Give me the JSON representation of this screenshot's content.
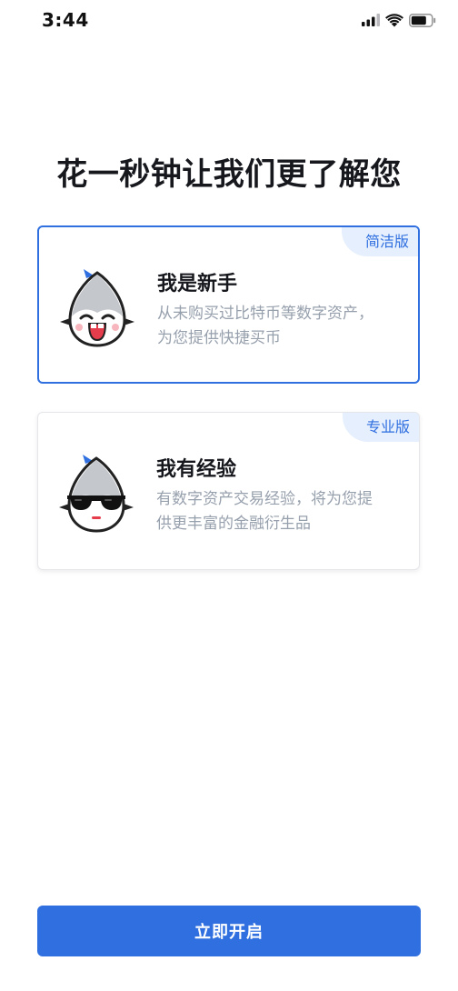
{
  "status_bar": {
    "time": "3:44",
    "icons": [
      "signal-icon",
      "wifi-icon",
      "battery-icon"
    ]
  },
  "title": "花一秒钟让我们更了解您",
  "options": [
    {
      "tag": "简洁版",
      "title": "我是新手",
      "description": "从未购买过比特币等数字资产，为您提供快捷买币",
      "avatar_icon": "shark-smile-mascot-icon",
      "selected": true
    },
    {
      "tag": "专业版",
      "title": "我有经验",
      "description": "有数字资产交易经验，将为您提供更丰富的金融衍生品",
      "avatar_icon": "shark-sunglasses-mascot-icon",
      "selected": false
    }
  ],
  "start_button": {
    "label": "立即开启"
  },
  "colors": {
    "accent": "#2f6fe0",
    "tag_background": "#e6effd",
    "title_text": "#16181d",
    "description_text": "#97a0ad"
  }
}
